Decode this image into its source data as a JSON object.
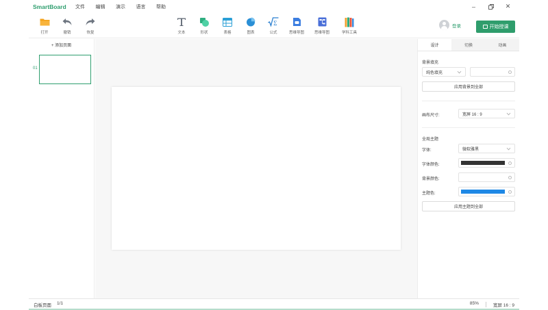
{
  "app": {
    "name": "SmartBoard"
  },
  "menu": [
    "文件",
    "编辑",
    "演示",
    "语言",
    "帮助"
  ],
  "toolbar": {
    "left": [
      {
        "label": "打开",
        "icon": "folder-icon"
      },
      {
        "label": "撤销",
        "icon": "undo-icon"
      },
      {
        "label": "恢复",
        "icon": "redo-icon"
      }
    ],
    "center": [
      {
        "label": "文本",
        "icon": "text-icon"
      },
      {
        "label": "形状",
        "icon": "shape-icon"
      },
      {
        "label": "表格",
        "icon": "table-icon"
      },
      {
        "label": "图表",
        "icon": "chart-icon"
      },
      {
        "label": "公式",
        "icon": "formula-icon"
      },
      {
        "label": "思维导图",
        "icon": "mindmap-icon"
      },
      {
        "label": "思维导图",
        "icon": "flowchart-icon"
      },
      {
        "label": "学科工具",
        "icon": "subject-tools-icon"
      }
    ]
  },
  "user": {
    "login_label": "登录"
  },
  "start_button": {
    "label": "开始授课"
  },
  "thumbs": {
    "add_page": "+ 添加页面",
    "slide_number": "01"
  },
  "props": {
    "tabs": [
      "设计",
      "切换",
      "动画"
    ],
    "background": {
      "title": "背景填充",
      "fill_type": "纯色填充",
      "apply_all": "应用背景到全部"
    },
    "canvas_size": {
      "label": "画布尺寸:",
      "value": "宽屏 16 : 9"
    },
    "theme": {
      "title": "全局主题",
      "font_label": "字体:",
      "font_value": "微软雅黑",
      "font_color_label": "字体颜色:",
      "font_color": "#333333",
      "bg_color_label": "背景颜色:",
      "theme_color_label": "主题色:",
      "theme_color": "#1e88e5",
      "apply_all": "应用主题到全部"
    }
  },
  "status": {
    "page_label": "白板页面",
    "page_count": "1/1",
    "zoom": "85%",
    "ratio": "宽屏 16 : 9"
  },
  "colors": {
    "brand": "#2f9d6c"
  }
}
